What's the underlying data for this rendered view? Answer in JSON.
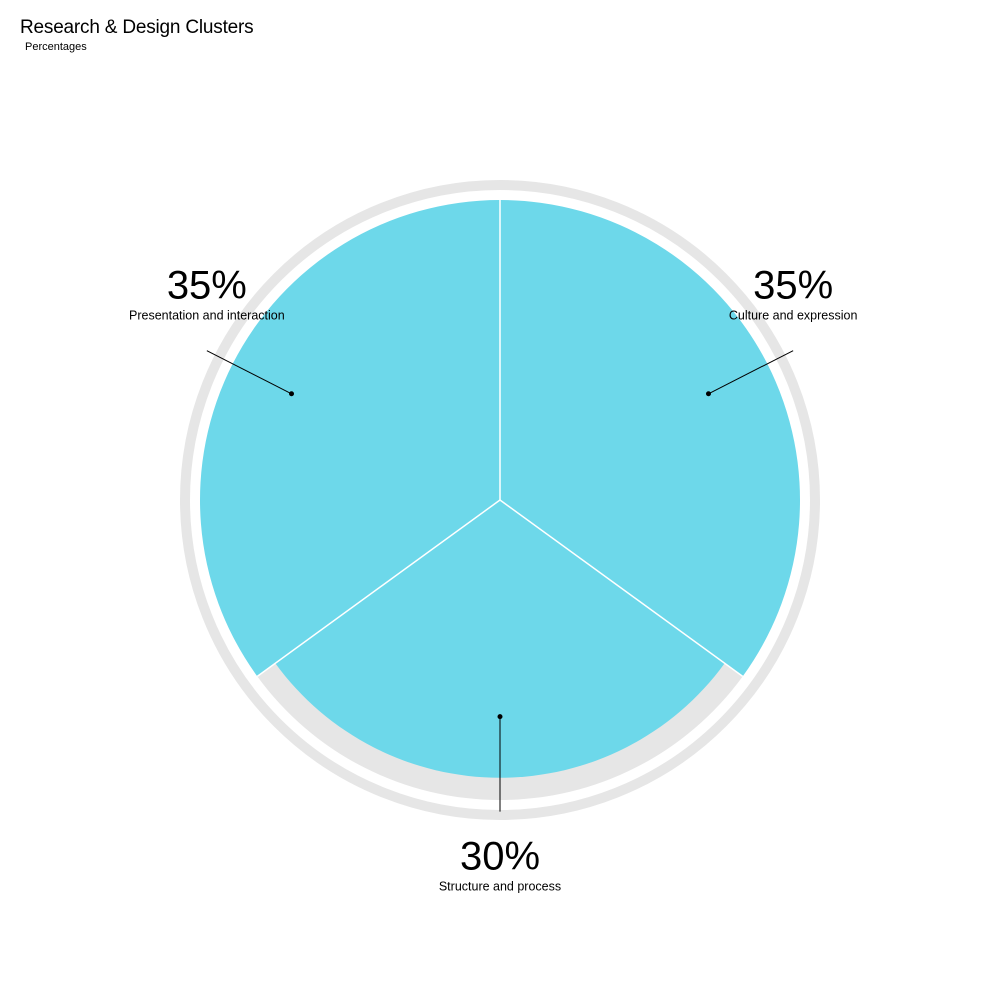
{
  "chart_title": "Research & Design Clusters",
  "chart_subtitle": "Percentages",
  "colors": {
    "slice_fill": "#6dd8ea",
    "track": "#e6e6e6",
    "separator": "#ffffff",
    "leader": "#000000"
  },
  "chart_data": {
    "type": "pie",
    "title": "Research & Design Clusters",
    "subtitle": "Percentages",
    "categories": [
      "Culture and expression",
      "Structure and process",
      "Presentation and interaction"
    ],
    "values": [
      35,
      30,
      35
    ],
    "labels": [
      {
        "percent": "35%",
        "name": "Culture and expression"
      },
      {
        "percent": "30%",
        "name": "Structure and process"
      },
      {
        "percent": "35%",
        "name": "Presentation and interaction"
      }
    ]
  }
}
